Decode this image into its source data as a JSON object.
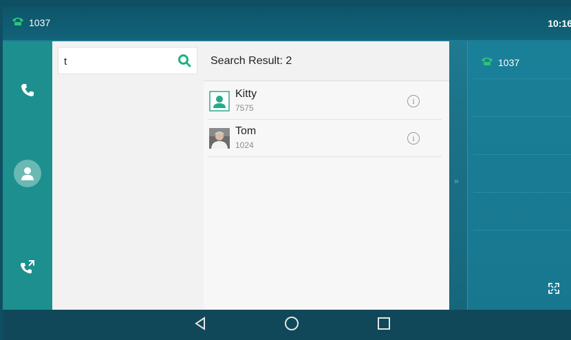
{
  "status_bar": {
    "line": "1037",
    "time": "10:16"
  },
  "rail": {
    "items": [
      {
        "name": "phone",
        "icon": "phone-icon"
      },
      {
        "name": "contacts",
        "icon": "contact-icon"
      },
      {
        "name": "history",
        "icon": "call-history-icon"
      }
    ]
  },
  "search": {
    "value": "t",
    "icon": "search-icon"
  },
  "results": {
    "title": "Search Result: 2",
    "contacts": [
      {
        "name": "Kitty",
        "number": "7575"
      },
      {
        "name": "Tom",
        "number": "1024"
      }
    ]
  },
  "line_panel": {
    "line": "1037"
  },
  "colors": {
    "accent": "#19b37b",
    "teal": "#1d8f8f"
  }
}
